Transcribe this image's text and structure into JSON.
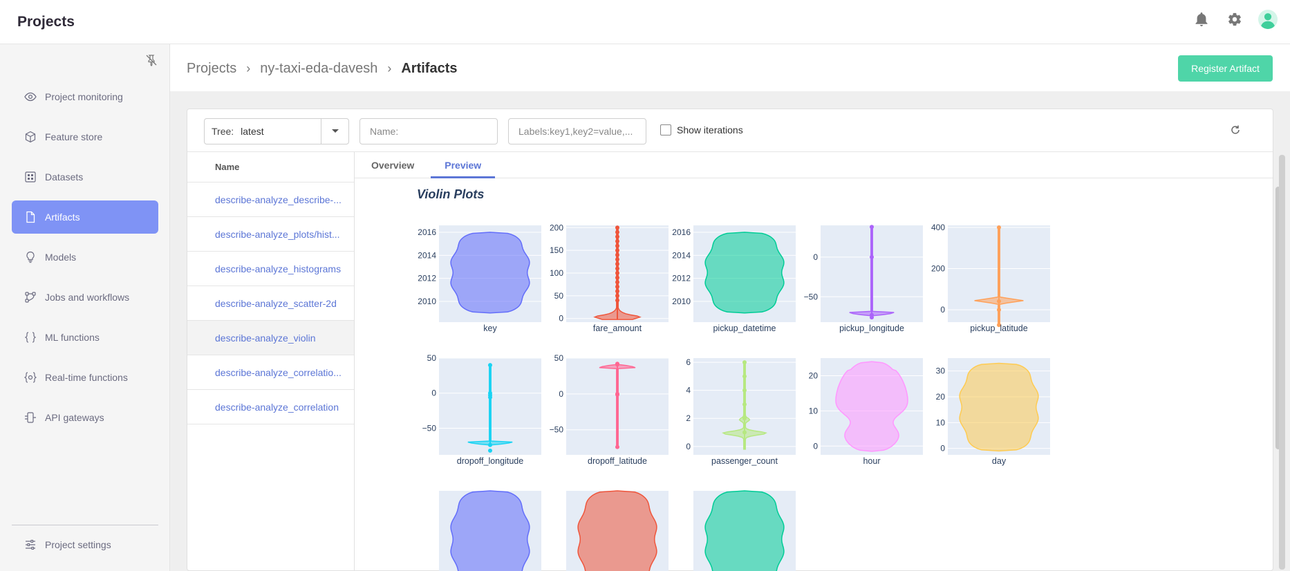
{
  "app": {
    "title": "Projects"
  },
  "topbar_icons": [
    "bell-icon",
    "gear-icon",
    "user-avatar-icon"
  ],
  "sidebar": {
    "items": [
      {
        "label": "Project monitoring",
        "icon": "eye-icon",
        "active": false
      },
      {
        "label": "Feature store",
        "icon": "box-icon",
        "active": false
      },
      {
        "label": "Datasets",
        "icon": "grid-icon",
        "active": false
      },
      {
        "label": "Artifacts",
        "icon": "file-icon",
        "active": true
      },
      {
        "label": "Models",
        "icon": "bulb-icon",
        "active": false
      },
      {
        "label": "Jobs and workflows",
        "icon": "workflow-icon",
        "active": false
      },
      {
        "label": "ML functions",
        "icon": "braces-icon",
        "active": false
      },
      {
        "label": "Real-time functions",
        "icon": "realtime-icon",
        "active": false
      },
      {
        "label": "API gateways",
        "icon": "gateway-icon",
        "active": false
      }
    ],
    "settings_label": "Project settings"
  },
  "breadcrumb": {
    "root": "Projects",
    "project": "ny-taxi-eda-davesh",
    "current": "Artifacts"
  },
  "register_button": "Register Artifact",
  "filters": {
    "tree_label": "Tree:",
    "tree_value": "latest",
    "name_placeholder": "Name:",
    "labels_placeholder": "Labels:key1,key2=value,...",
    "show_iterations": "Show iterations"
  },
  "list": {
    "header": "Name",
    "rows": [
      "describe-analyze_describe-...",
      "describe-analyze_plots/hist...",
      "describe-analyze_histograms",
      "describe-analyze_scatter-2d",
      "describe-analyze_violin",
      "describe-analyze_correlatio...",
      "describe-analyze_correlation"
    ],
    "selected_index": 4
  },
  "tabs": [
    "Overview",
    "Preview"
  ],
  "active_tab": "Preview",
  "preview": {
    "title": "Violin Plots"
  },
  "chart_data": [
    {
      "type": "violin",
      "xlabel": "key",
      "color": "#636efa",
      "yticks": [
        2010,
        2012,
        2014,
        2016
      ],
      "ylim": [
        2008.2,
        2016.6
      ],
      "shape": "blob",
      "range": [
        2009.0,
        2016.0
      ],
      "points": []
    },
    {
      "type": "violin",
      "xlabel": "fare_amount",
      "color": "#ef553b",
      "yticks": [
        0,
        50,
        100,
        150,
        200
      ],
      "ylim": [
        -8,
        205
      ],
      "shape": "skewed-bottom",
      "range": [
        -2,
        200
      ],
      "points": [
        200,
        190,
        180,
        170,
        160,
        150,
        140,
        130,
        120,
        110,
        100,
        90,
        80,
        70,
        60,
        50,
        40
      ]
    },
    {
      "type": "violin",
      "xlabel": "pickup_datetime",
      "color": "#00cc96",
      "yticks": [
        2010,
        2012,
        2014,
        2016
      ],
      "ylim": [
        2008.2,
        2016.6
      ],
      "shape": "blob",
      "range": [
        2009.0,
        2016.0
      ],
      "points": []
    },
    {
      "type": "violin",
      "xlabel": "pickup_longitude",
      "color": "#ab63fa",
      "yticks": [
        -50,
        0
      ],
      "ylim": [
        -82,
        40
      ],
      "shape": "thin-bottom",
      "range": [
        -74,
        38
      ],
      "points": [
        38,
        0,
        -73,
        -76
      ]
    },
    {
      "type": "violin",
      "xlabel": "pickup_latitude",
      "color": "#ffa15a",
      "yticks": [
        0,
        200,
        400
      ],
      "ylim": [
        -60,
        410
      ],
      "shape": "thin-middle",
      "range": [
        -74,
        400
      ],
      "points": [
        400,
        41,
        0,
        -74
      ]
    },
    {
      "type": "violin",
      "xlabel": "dropoff_longitude",
      "color": "#19d3f3",
      "yticks": [
        -50,
        0,
        50
      ],
      "ylim": [
        -88,
        50
      ],
      "shape": "thin-bottom",
      "range": [
        -74,
        40
      ],
      "points": [
        40,
        0,
        -3,
        -6,
        -74,
        -82
      ]
    },
    {
      "type": "violin",
      "xlabel": "dropoff_latitude",
      "color": "#ff6692",
      "yticks": [
        -50,
        0,
        50
      ],
      "ylim": [
        -85,
        50
      ],
      "shape": "thin-top",
      "range": [
        -74,
        41
      ],
      "points": [
        41,
        42,
        0,
        -1,
        -74
      ]
    },
    {
      "type": "violin",
      "xlabel": "passenger_count",
      "color": "#b6e880",
      "yticks": [
        0,
        2,
        4,
        6
      ],
      "ylim": [
        -0.6,
        6.3
      ],
      "shape": "thin-low",
      "range": [
        -0.2,
        6
      ],
      "points": [
        6,
        5,
        4,
        3,
        2,
        1
      ]
    },
    {
      "type": "violin",
      "xlabel": "hour",
      "color": "#ff97ff",
      "yticks": [
        0,
        10,
        20
      ],
      "ylim": [
        -2.5,
        25
      ],
      "shape": "hourglass",
      "range": [
        -1.5,
        24
      ],
      "points": []
    },
    {
      "type": "violin",
      "xlabel": "day",
      "color": "#fecb52",
      "yticks": [
        0,
        10,
        20,
        30
      ],
      "ylim": [
        -2.5,
        35
      ],
      "shape": "blob",
      "range": [
        -1,
        33
      ],
      "points": []
    },
    {
      "type": "violin",
      "xlabel": "",
      "color": "#636efa",
      "yticks": [],
      "ylim": [
        0,
        1
      ],
      "shape": "blob",
      "range": [
        0,
        1
      ],
      "points": []
    },
    {
      "type": "violin",
      "xlabel": "",
      "color": "#ef553b",
      "yticks": [],
      "ylim": [
        0,
        1
      ],
      "shape": "blob",
      "range": [
        0,
        1
      ],
      "points": []
    },
    {
      "type": "violin",
      "xlabel": "",
      "color": "#00cc96",
      "yticks": [],
      "ylim": [
        0,
        1
      ],
      "shape": "blob",
      "range": [
        0,
        1
      ],
      "points": []
    }
  ]
}
